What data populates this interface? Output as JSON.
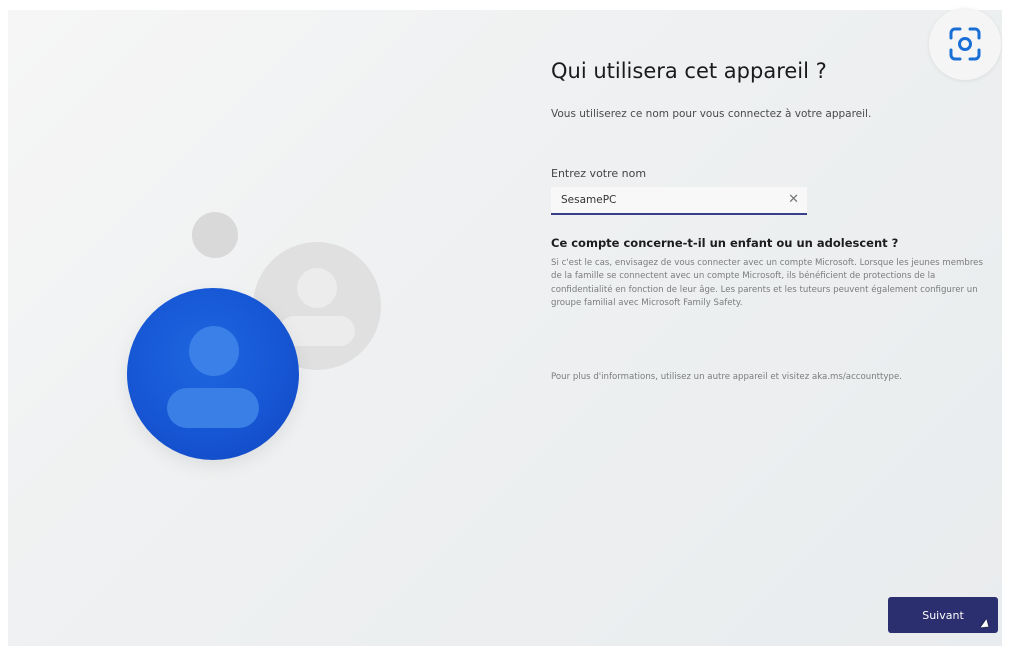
{
  "setup": {
    "title": "Qui utilisera cet appareil ?",
    "subtitle": "Vous utiliserez ce nom pour vous connectez à votre appareil.",
    "name_label": "Entrez votre nom",
    "name_value": "SesamePC",
    "clear_glyph": "✕",
    "question": "Ce compte concerne-t-il un enfant ou un adolescent ?",
    "paragraph": "Si c'est le cas, envisagez de vous connecter avec un compte Microsoft. Lorsque les jeunes membres de la famille se connectent avec un compte Microsoft, ils bénéficient de protections de la confidentialité en fonction de leur âge. Les parents et les tuteurs peuvent également configurer un groupe familial avec Microsoft Family Safety.",
    "more_info": "Pour plus d'informations, utilisez un autre appareil et visitez aka.ms/accounttype.",
    "next_label": "Suivant"
  },
  "overlay": {
    "icon": "lens-scan-icon"
  },
  "colors": {
    "accent_button": "#2b2f6f",
    "avatar_blue": "#1656d4",
    "input_underline": "#3a3f8c"
  }
}
